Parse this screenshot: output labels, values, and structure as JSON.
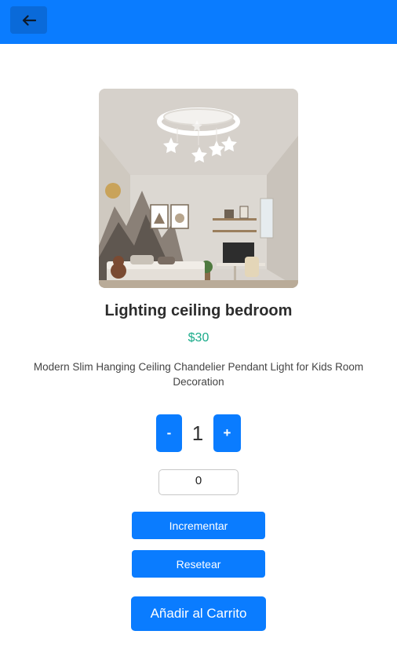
{
  "header": {
    "back_icon": "arrow-left-icon",
    "accent": "#0a7cff"
  },
  "product": {
    "title": "Lighting ceiling bedroom",
    "price": "$30",
    "description": "Modern Slim Hanging Ceiling Chandelier Pendant Light for Kids Room Decoration",
    "price_color": "#1aab8a"
  },
  "quantity": {
    "minus_label": "-",
    "value": "1",
    "plus_label": "+"
  },
  "counter": {
    "value": "0"
  },
  "buttons": {
    "increment_label": "Incrementar",
    "reset_label": "Resetear",
    "add_to_cart_label": "Añadir al Carrito"
  }
}
